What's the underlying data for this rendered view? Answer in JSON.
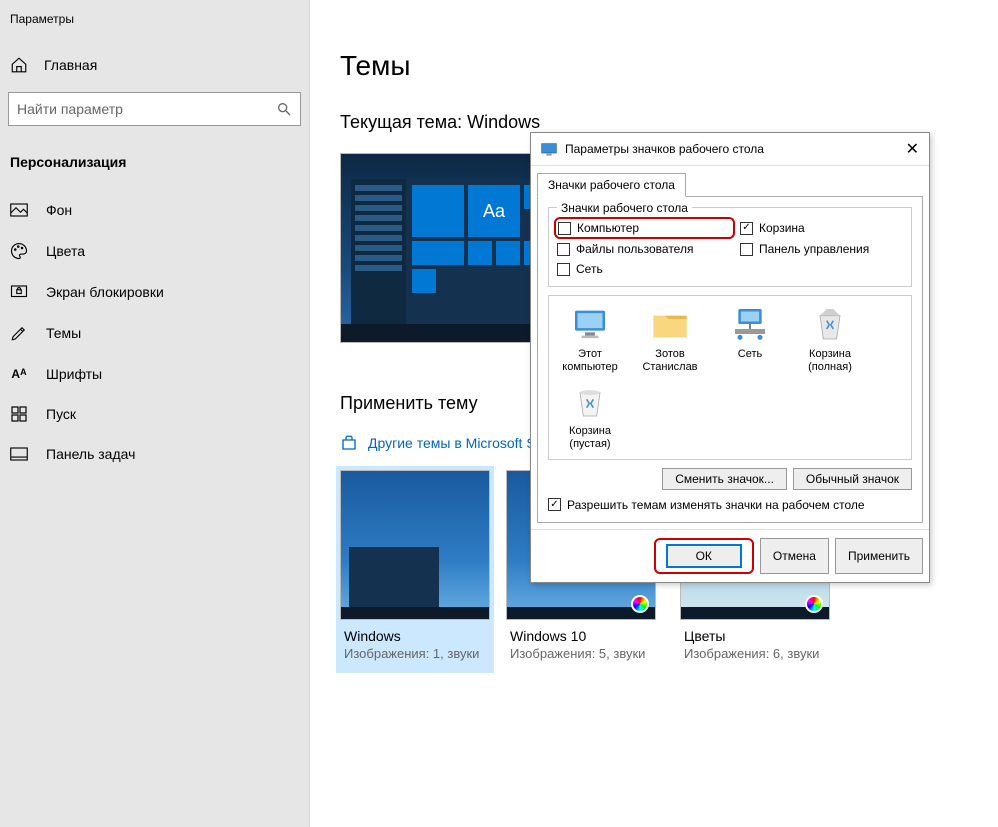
{
  "sidebar": {
    "app_title": "Параметры",
    "home": "Главная",
    "search_placeholder": "Найти параметр",
    "section": "Персонализация",
    "items": [
      {
        "label": "Фон"
      },
      {
        "label": "Цвета"
      },
      {
        "label": "Экран блокировки"
      },
      {
        "label": "Темы"
      },
      {
        "label": "Шрифты"
      },
      {
        "label": "Пуск"
      },
      {
        "label": "Панель задач"
      }
    ]
  },
  "main": {
    "title": "Темы",
    "current_theme_label": "Текущая тема: Windows",
    "apply_label": "Применить тему",
    "store_link": "Другие темы в Microsoft S...",
    "preview_tile_text": "Aa",
    "themes": [
      {
        "name": "Windows",
        "meta": "Изображения: 1, звуки"
      },
      {
        "name": "Windows 10",
        "meta": "Изображения: 5, звуки"
      },
      {
        "name": "Цветы",
        "meta": "Изображения: 6, звуки"
      }
    ]
  },
  "dialog": {
    "title": "Параметры значков рабочего стола",
    "tab": "Значки рабочего стола",
    "fieldset": "Значки рабочего стола",
    "checks": {
      "computer": "Компьютер",
      "recycle": "Корзина",
      "userfiles": "Файлы пользователя",
      "cpanel": "Панель управления",
      "network": "Сеть"
    },
    "icons": [
      {
        "label": "Этот компьютер"
      },
      {
        "label": "Зотов Станислав"
      },
      {
        "label": "Сеть"
      },
      {
        "label": "Корзина (полная)"
      },
      {
        "label": "Корзина (пустая)"
      }
    ],
    "change_icon": "Сменить значок...",
    "default_icon": "Обычный значок",
    "allow_themes": "Разрешить темам изменять значки на рабочем столе",
    "ok": "ОК",
    "cancel": "Отмена",
    "apply": "Применить"
  }
}
